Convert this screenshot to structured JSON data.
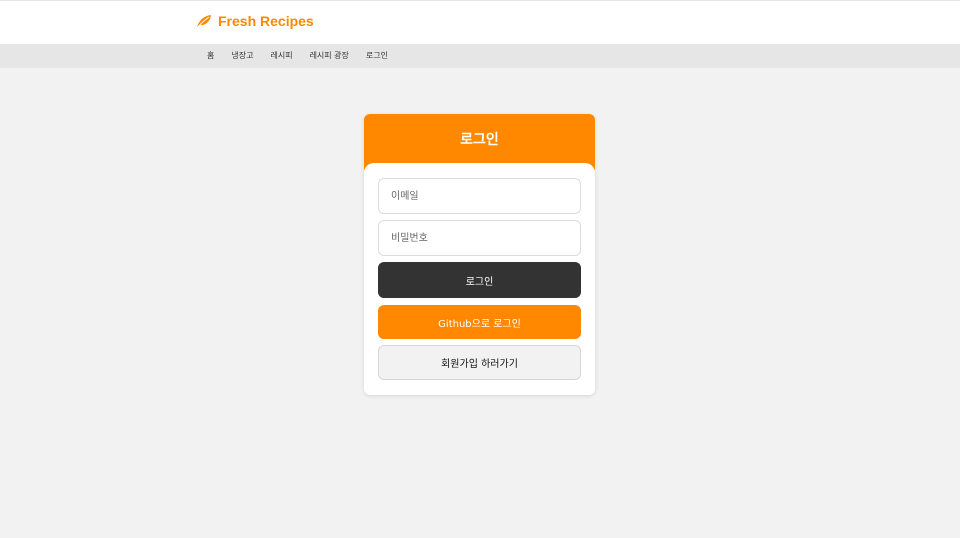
{
  "header": {
    "brand_name": "Fresh Recipes",
    "brand_icon": "leaf-icon",
    "brand_color": "#ff8800"
  },
  "nav": {
    "items": [
      "홈",
      "냉장고",
      "레시피",
      "레시피 광장",
      "로그인"
    ]
  },
  "login": {
    "title": "로그인",
    "email_placeholder": "이메일",
    "password_placeholder": "비밀번호",
    "login_button": "로그인",
    "github_button": "Github으로 로그인",
    "signup_button": "회원가입 하러가기",
    "accent_color": "#ff8800",
    "dark_color": "#333333"
  }
}
